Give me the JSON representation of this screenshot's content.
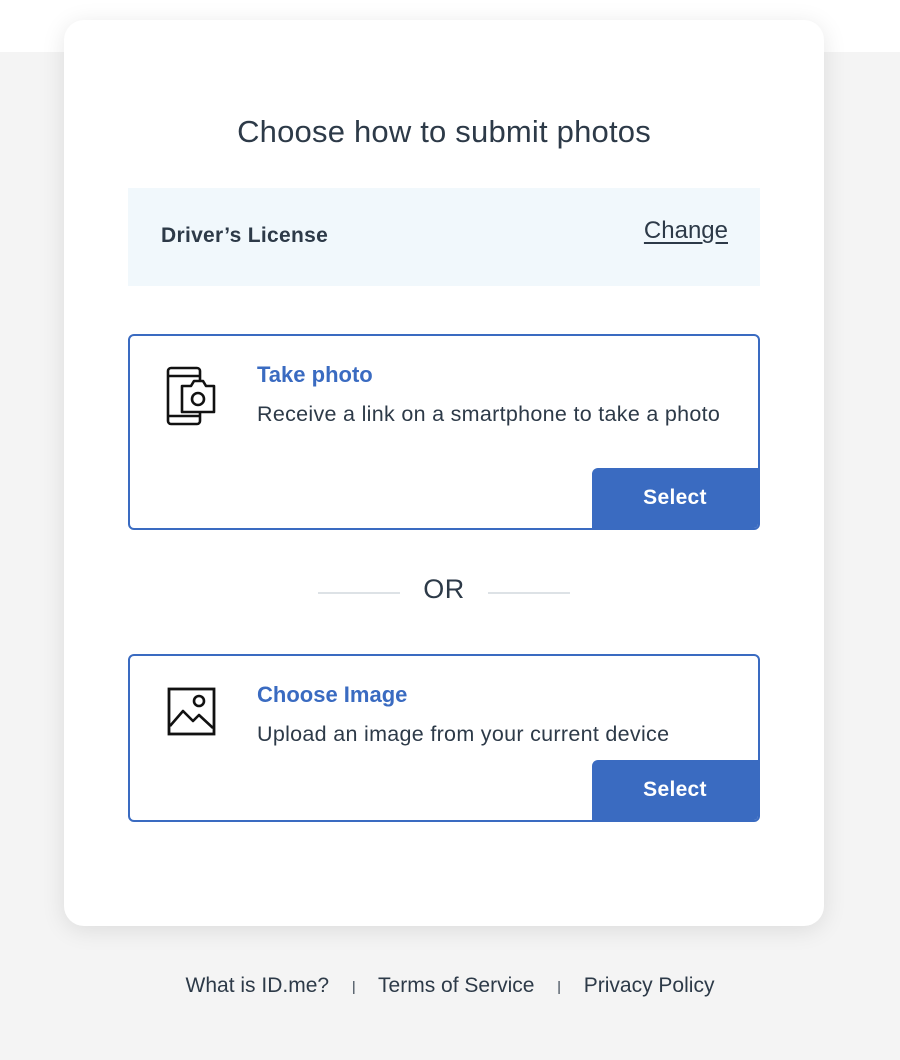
{
  "page": {
    "title": "Choose how to submit photos"
  },
  "document": {
    "type_label": "Driver’s License",
    "change_label": "Change"
  },
  "options": {
    "take_photo": {
      "title": "Take photo",
      "description": "Receive a link on a smartphone to take a photo",
      "button_label": "Select",
      "icon": "phone-camera-icon"
    },
    "choose_image": {
      "title": "Choose Image",
      "description": "Upload an image from your current device",
      "button_label": "Select",
      "icon": "image-icon"
    }
  },
  "divider": {
    "label": "OR"
  },
  "footer": {
    "links": [
      "What is ID.me?",
      "Terms of Service",
      "Privacy Policy"
    ],
    "separator": "|"
  },
  "colors": {
    "accent": "#3a6bc1",
    "text": "#2d3a48",
    "panel_bg": "#f1f8fc",
    "page_bg": "#f4f4f4"
  }
}
